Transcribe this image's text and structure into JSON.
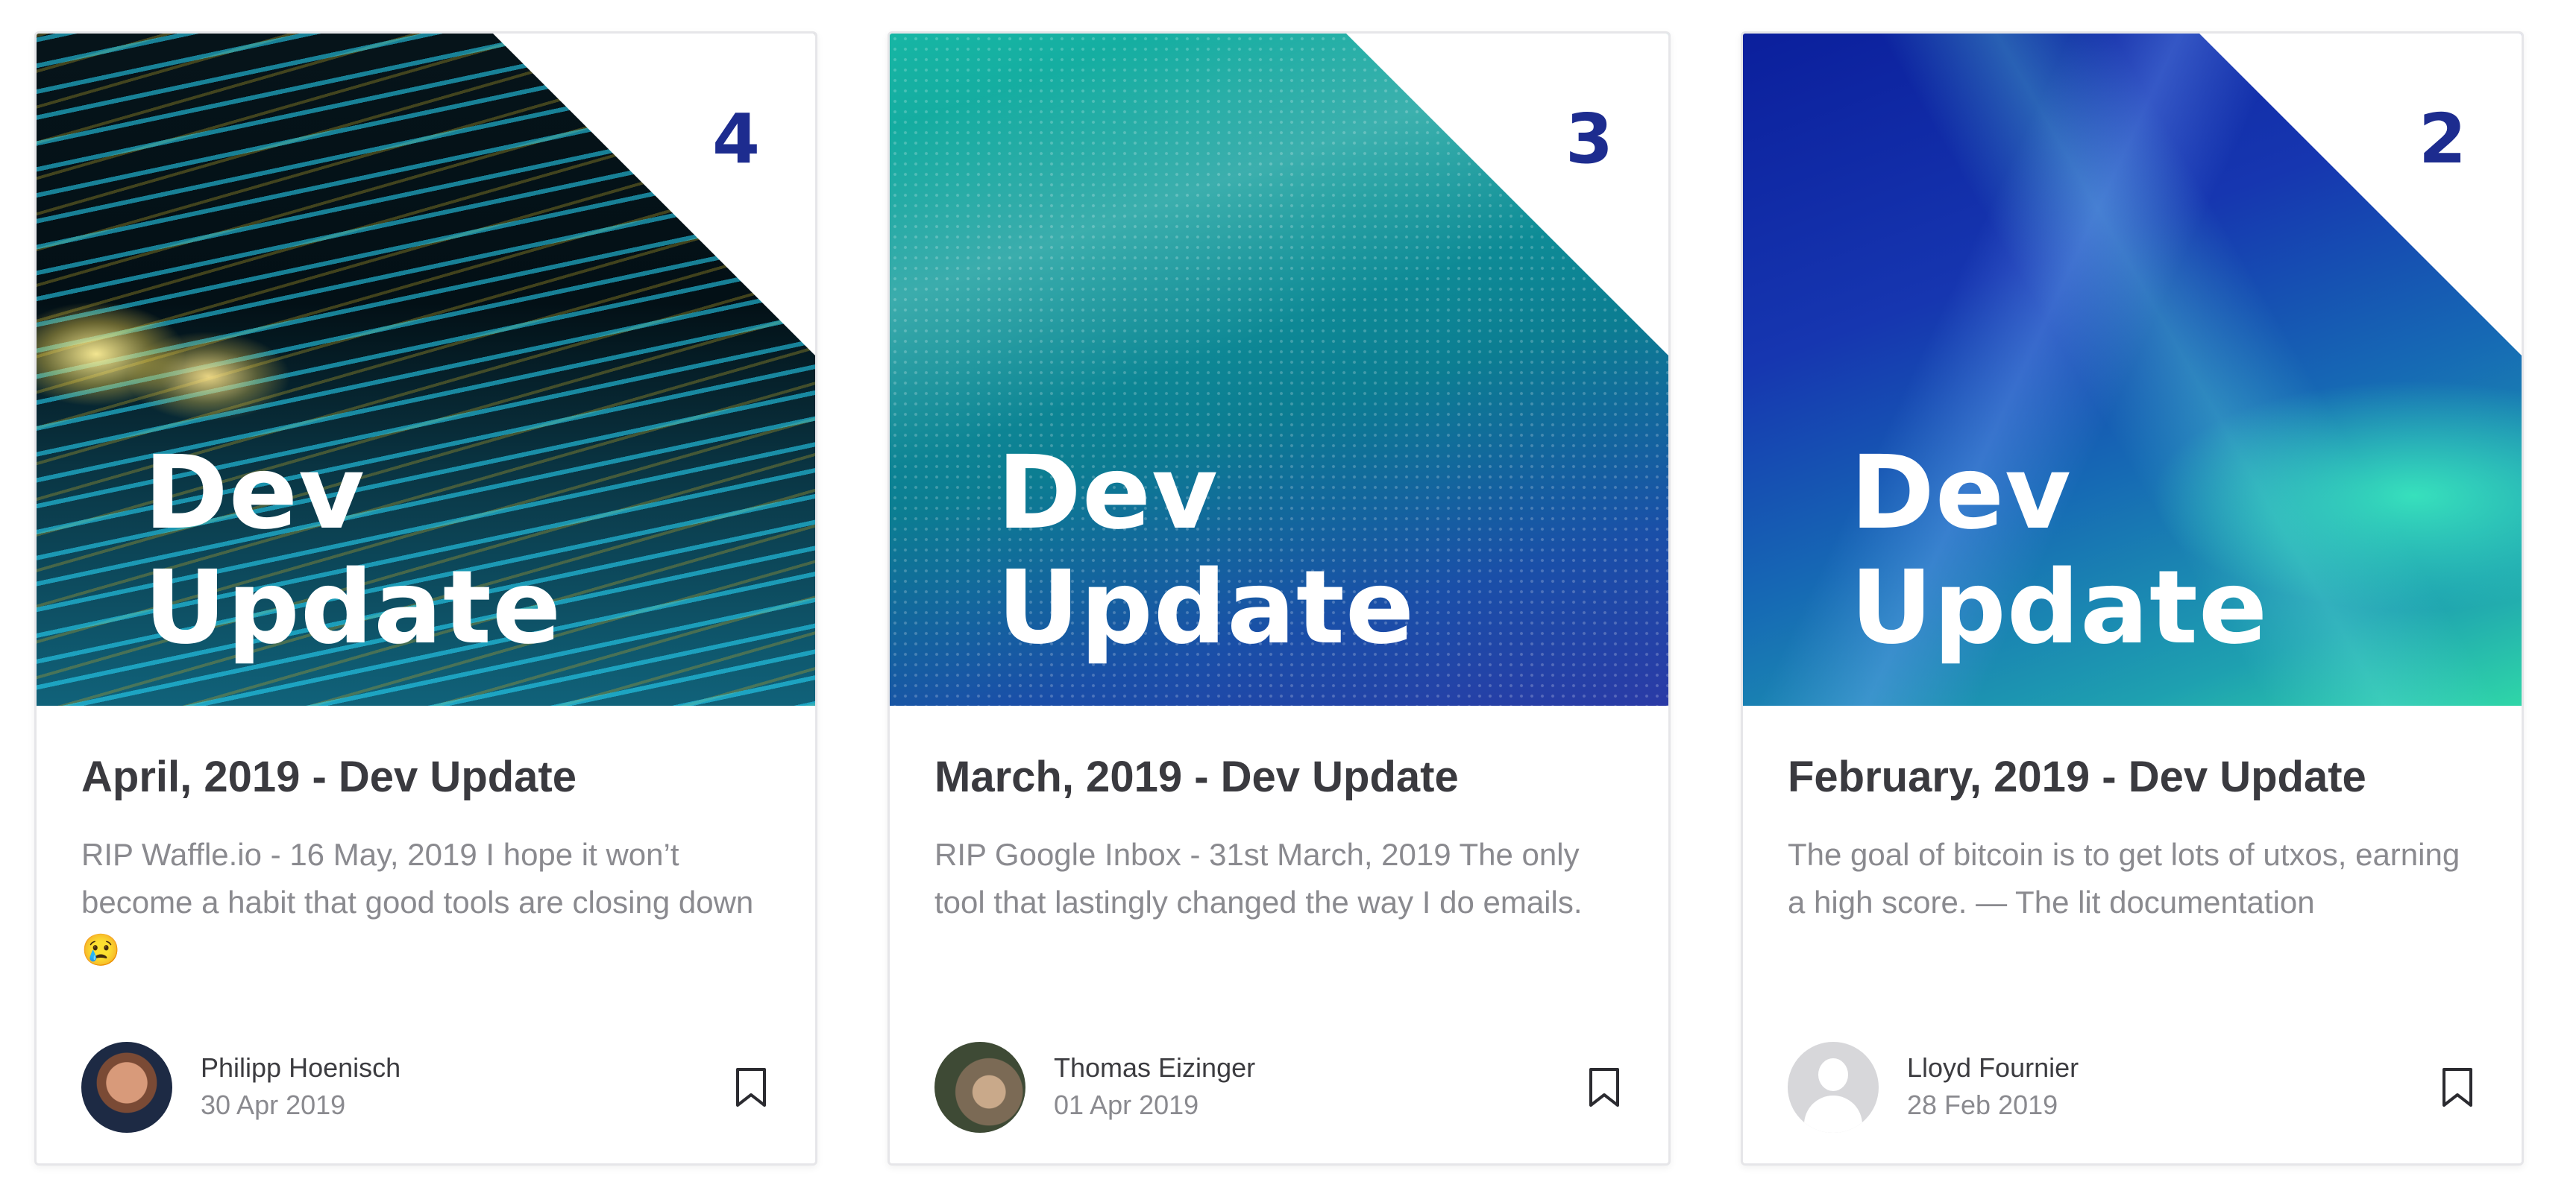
{
  "cards": [
    {
      "cover_text_line1": "Dev",
      "cover_text_line2": "Update",
      "issue_number": "4",
      "title": "April, 2019 - Dev Update",
      "excerpt": "RIP Waffle.io - 16 May, 2019 I hope it won’t become a habit that good tools are closing down 😢",
      "author": "Philipp Hoenisch",
      "date": "30 Apr 2019",
      "bookmark_icon": "bookmark-icon"
    },
    {
      "cover_text_line1": "Dev",
      "cover_text_line2": "Update",
      "issue_number": "3",
      "title": "March, 2019 - Dev Update",
      "excerpt": "RIP Google Inbox - 31st March, 2019 The only tool that lastingly changed the way I do emails.",
      "author": "Thomas Eizinger",
      "date": "01 Apr 2019",
      "bookmark_icon": "bookmark-icon"
    },
    {
      "cover_text_line1": "Dev",
      "cover_text_line2": "Update",
      "issue_number": "2",
      "title": "February, 2019 - Dev Update",
      "excerpt": "The goal of bitcoin is to get lots of utxos, earning a high score. — The lit documentation",
      "author": "Lloyd Fournier",
      "date": "28 Feb 2019",
      "bookmark_icon": "bookmark-icon"
    }
  ],
  "colors": {
    "issue_number": "#1d2c8f",
    "title": "#3a3a3f",
    "muted": "#8a8a8f",
    "card_border": "#e6e6e9"
  }
}
